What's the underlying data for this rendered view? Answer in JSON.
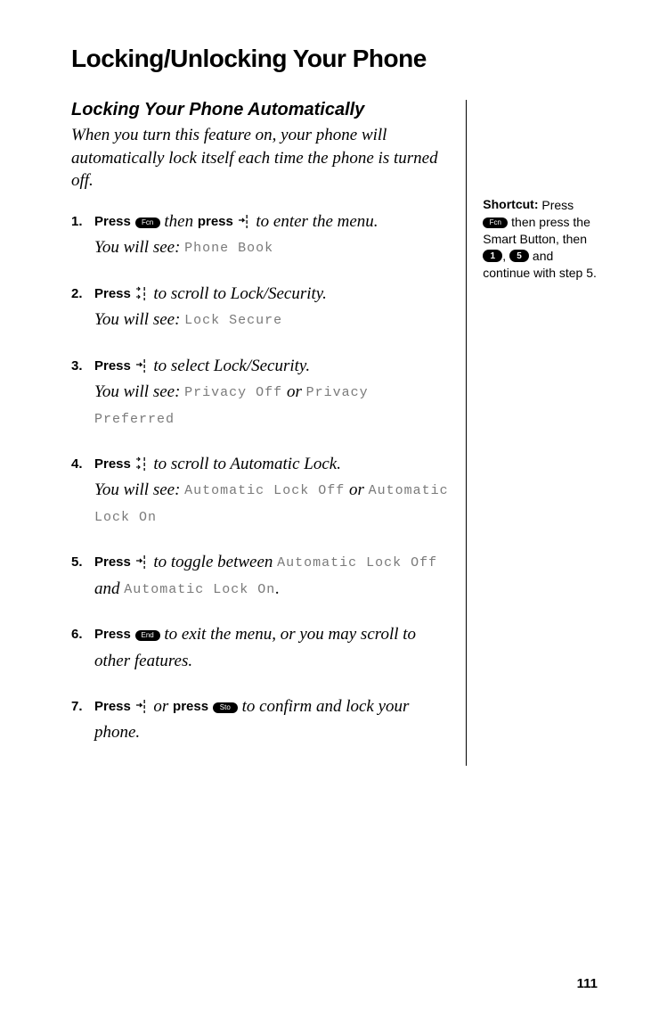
{
  "title": "Locking/Unlocking Your Phone",
  "subtitle": "Locking Your Phone Automatically",
  "intro": "When you turn this feature on, your phone will automatically lock itself each time the phone is turned off.",
  "labels": {
    "press": "Press",
    "then_press": " then ",
    "press2": "press",
    "you_will_see": "You will see: ",
    "or": " or ",
    "and": " and ",
    "to_enter_menu": " to enter the menu.",
    "to_scroll_lock": " to scroll to Lock/Security.",
    "to_select_lock": " to select Lock/Security.",
    "to_scroll_auto": " to scroll to Automatic Lock.",
    "to_toggle": " to toggle between ",
    "to_exit": " to exit the menu, or you may scroll to other features.",
    "or_word": " or ",
    "to_confirm": " to confirm and lock your phone.",
    "period": "."
  },
  "screens": {
    "phone_book": "Phone Book",
    "lock_secure": "Lock Secure",
    "privacy_off": "Privacy Off",
    "privacy_pref": "Privacy Preferred",
    "auto_off": "Automatic Lock Off",
    "auto_on": "Automatic Lock On"
  },
  "buttons": {
    "fcn": "Fcn",
    "end": "End",
    "sto": "Sto",
    "one": "1",
    "five": "5"
  },
  "shortcut": {
    "label": "Shortcut:",
    "t1": " Press ",
    "t2": " then press the Smart Button, then ",
    "comma": ", ",
    "t3": " and continue with step 5."
  },
  "page_number": "111"
}
